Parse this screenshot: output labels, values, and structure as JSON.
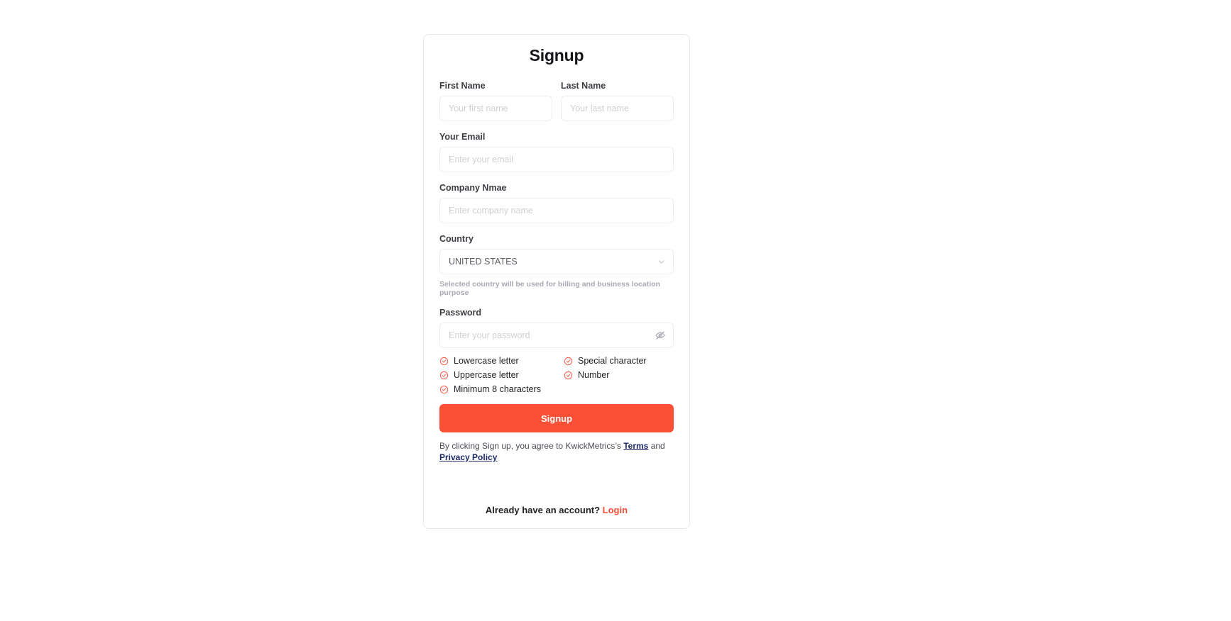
{
  "card": {
    "title": "Signup"
  },
  "fields": {
    "first_name": {
      "label": "First Name",
      "placeholder": "Your first name",
      "value": ""
    },
    "last_name": {
      "label": "Last Name",
      "placeholder": "Your last name",
      "value": ""
    },
    "email": {
      "label": "Your Email",
      "placeholder": "Enter your email",
      "value": ""
    },
    "company": {
      "label": "Company Nmae",
      "placeholder": "Enter company name",
      "value": ""
    },
    "country": {
      "label": "Country",
      "selected": "UNITED STATES",
      "hint": "Selected country will be used for billing and business location purpose",
      "chevron_icon": "chevron-down-icon"
    },
    "password": {
      "label": "Password",
      "placeholder": "Enter your password",
      "value": "",
      "toggle_icon": "eye-off-icon"
    }
  },
  "password_requirements": [
    {
      "label": "Lowercase letter",
      "icon": "check-circle-icon"
    },
    {
      "label": "Special character",
      "icon": "check-circle-icon"
    },
    {
      "label": "Uppercase letter",
      "icon": "check-circle-icon"
    },
    {
      "label": "Number",
      "icon": "check-circle-icon"
    },
    {
      "label": "Minimum 8 characters",
      "icon": "check-circle-icon"
    }
  ],
  "actions": {
    "submit_label": "Signup"
  },
  "terms": {
    "prefix": "By clicking Sign up, you agree to KwickMetrics’s ",
    "terms_link": "Terms",
    "middle": " and ",
    "privacy_link": "Privacy Policy"
  },
  "footer": {
    "text": "Already have an account?",
    "login_link": "Login"
  },
  "colors": {
    "accent": "#fb4f36",
    "link": "#1c2a66",
    "border": "#ececee",
    "card_border": "#e8e8ea"
  }
}
